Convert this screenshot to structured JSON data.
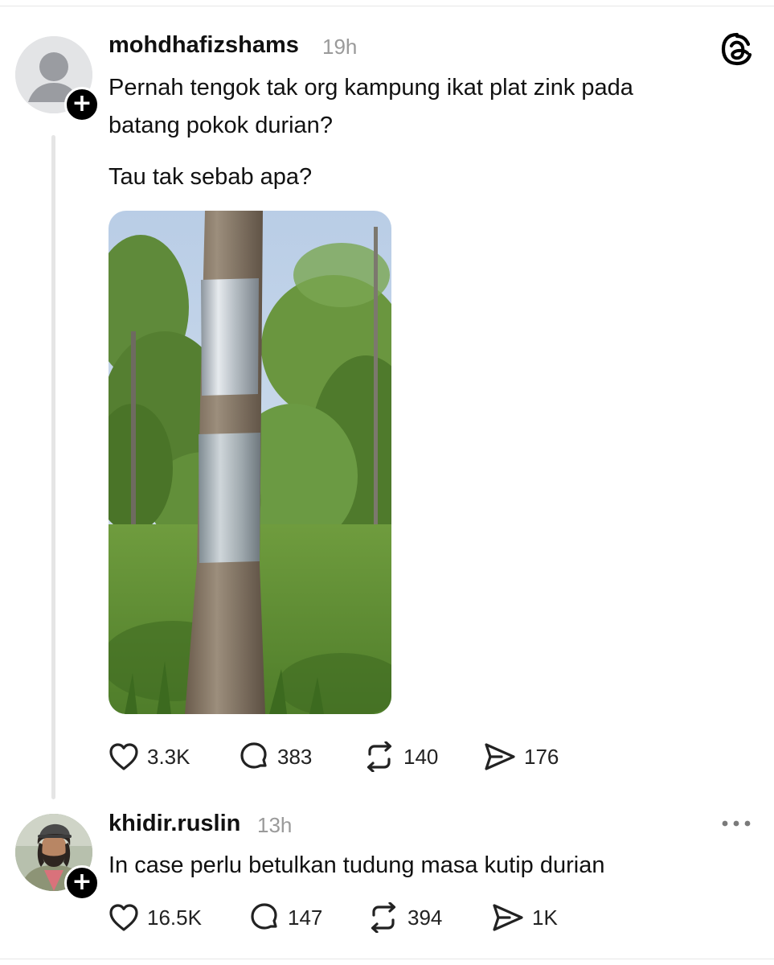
{
  "post": {
    "username": "mohdhafizshams",
    "time": "19h",
    "text_line1": "Pernah tengok tak org kampung ikat plat zink pada",
    "text_line2": "batang pokok durian?",
    "text_line3": "Tau tak sebab apa?",
    "media_icon": "photo-tree-with-zinc-bands",
    "actions": {
      "likes": "3.3K",
      "replies": "383",
      "reposts": "140",
      "shares": "176"
    }
  },
  "reply": {
    "username": "khidir.ruslin",
    "time": "13h",
    "text": "In case perlu betulkan tudung masa kutip durian",
    "actions": {
      "likes": "16.5K",
      "replies": "147",
      "reposts": "394",
      "shares": "1K"
    }
  },
  "icons": {
    "app": "threads-logo-icon",
    "more": "more-horizontal-icon",
    "like": "heart-icon",
    "reply": "comment-icon",
    "repost": "repost-icon",
    "share": "send-icon",
    "follow": "plus-icon"
  }
}
